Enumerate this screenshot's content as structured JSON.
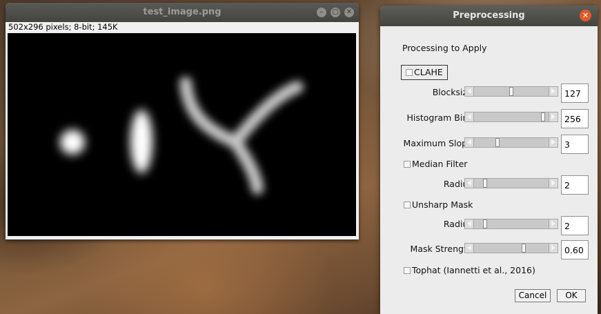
{
  "image_window": {
    "title": "test_image.png",
    "info": "502x296 pixels; 8-bit; 145K",
    "controls": {
      "minimize": "–",
      "maximize": "▢",
      "close": "✕"
    }
  },
  "dialog": {
    "title": "Preprocessing",
    "close": "✕",
    "heading": "Processing to Apply",
    "clahe": {
      "label": "CLAHE",
      "checked": false,
      "blocksize": {
        "label": "Blocksize:",
        "value": "127",
        "level": 0.5
      },
      "histogram_bins": {
        "label": "Histogram Bins:",
        "value": "256",
        "level": 0.95
      },
      "maximum_slope": {
        "label": "Maximum Slope:",
        "value": "3",
        "level": 0.3
      }
    },
    "median_filter": {
      "label": "Median Filter",
      "checked": false,
      "radius": {
        "label": "Radius:",
        "value": "2",
        "level": 0.13
      }
    },
    "unsharp_mask": {
      "label": "Unsharp Mask",
      "checked": false,
      "radius": {
        "label": "Radius:",
        "value": "2",
        "level": 0.13
      },
      "mask_strength": {
        "label": "Mask Strength:",
        "value": "0.60",
        "level": 0.68
      }
    },
    "tophat": {
      "label": "Tophat (Iannetti et al., 2016)",
      "checked": false
    },
    "buttons": {
      "cancel": "Cancel",
      "ok": "OK"
    }
  }
}
